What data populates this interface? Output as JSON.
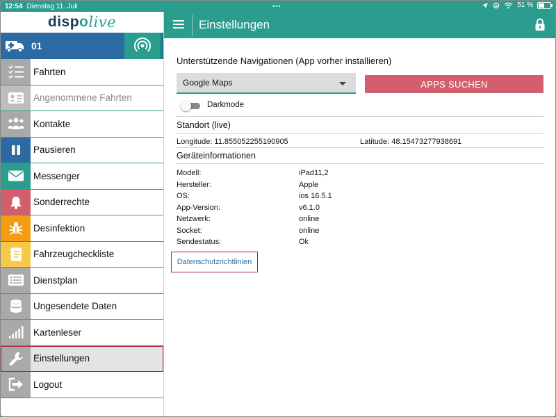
{
  "statusbar": {
    "time": "12:54",
    "date": "Dienstag 11. Juli",
    "battery": "51 %",
    "battery_level": 0.51
  },
  "sidebar": {
    "logo": {
      "part1": "disp",
      "part2": "o",
      "part3": "live"
    },
    "vehicle": {
      "label": "01"
    },
    "items": [
      {
        "label": "Fahrten",
        "icon": "checklist-icon",
        "color": "#a9a9a9"
      },
      {
        "label": "Angenommene Fahrten",
        "icon": "id-card-icon",
        "color": "#bdbdbd"
      },
      {
        "label": "Kontakte",
        "icon": "people-icon",
        "color": "#a9a9a9"
      },
      {
        "label": "Pausieren",
        "icon": "pause-icon",
        "color": "#2c6aa3"
      },
      {
        "label": "Messenger",
        "icon": "envelope-icon",
        "color": "#2a9d8f"
      },
      {
        "label": "Sonderrechte",
        "icon": "bell-icon",
        "color": "#d35f6e"
      },
      {
        "label": "Desinfektion",
        "icon": "bug-icon",
        "color": "#f39c12"
      },
      {
        "label": "Fahrzeugcheckliste",
        "icon": "notebook-icon",
        "color": "#f7c948"
      },
      {
        "label": "Dienstplan",
        "icon": "list-icon",
        "color": "#a9a9a9"
      },
      {
        "label": "Ungesendete Daten",
        "icon": "database-icon",
        "color": "#a9a9a9"
      },
      {
        "label": "Kartenleser",
        "icon": "signal-bars-icon",
        "color": "#a9a9a9"
      },
      {
        "label": "Einstellungen",
        "icon": "wrench-icon",
        "color": "#a9a9a9"
      },
      {
        "label": "Logout",
        "icon": "logout-icon",
        "color": "#a9a9a9"
      }
    ]
  },
  "header": {
    "title": "Einstellungen"
  },
  "settings": {
    "nav_title": "Unterstützende Navigationen (App vorher installieren)",
    "nav_selected": "Google Maps",
    "apps_button": "APPS SUCHEN",
    "darkmode_label": "Darkmode",
    "location_title": "Standort (live)",
    "longitude": "Longitude: 11.855052255190905",
    "latitude": "Latitude: 48.15473277938691",
    "device_title": "Geräteinformationen",
    "device_info": [
      {
        "label": "Modell:",
        "value": "iPad11,2"
      },
      {
        "label": "Hersteller:",
        "value": "Apple"
      },
      {
        "label": "OS:",
        "value": "ios 16.5.1"
      },
      {
        "label": "App-Version:",
        "value": "v6.1.0"
      },
      {
        "label": "Netzwerk:",
        "value": "online"
      },
      {
        "label": "Socket:",
        "value": "online"
      },
      {
        "label": "Sendestatus:",
        "value": "Ok"
      }
    ],
    "privacy_link": "Datenschutzrichtlinien"
  },
  "colors": {
    "teal": "#2a9d8f",
    "blue": "#2c6aa3",
    "red": "#d35f6e",
    "highlight_border": "#b0243a"
  }
}
